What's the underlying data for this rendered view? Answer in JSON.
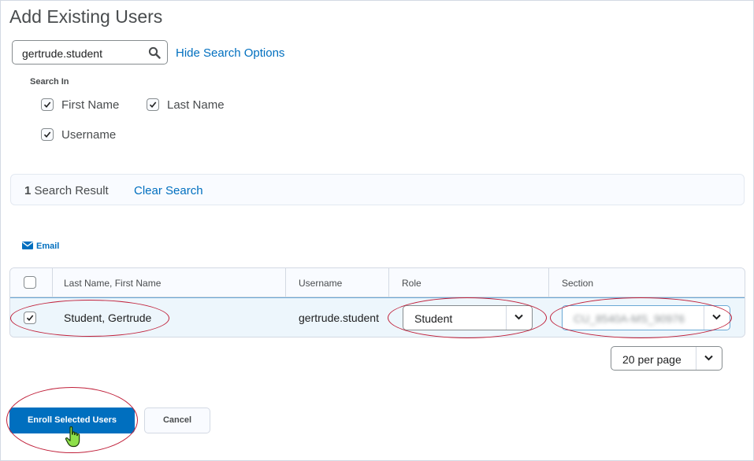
{
  "page": {
    "title": "Add Existing Users"
  },
  "search": {
    "value": "gertrude.student",
    "hide_options_link": "Hide Search Options",
    "search_in_label": "Search In",
    "options": [
      {
        "label": "First Name",
        "checked": true
      },
      {
        "label": "Last Name",
        "checked": true
      },
      {
        "label": "Username",
        "checked": true
      }
    ]
  },
  "results": {
    "count": "1",
    "label": "Search Result",
    "clear_link": "Clear Search"
  },
  "actions": {
    "email_label": "Email"
  },
  "table": {
    "headers": [
      "Last Name, First Name",
      "Username",
      "Role",
      "Section"
    ],
    "rows": [
      {
        "name": "Student, Gertrude",
        "username": "gertrude.student",
        "role": "Student",
        "section": "CU_8540A-MS_90976",
        "selected": true
      }
    ]
  },
  "pagination": {
    "per_page": "20 per page"
  },
  "buttons": {
    "enroll": "Enroll Selected Users",
    "cancel": "Cancel"
  },
  "colors": {
    "accent": "#006fbf",
    "annotation": "#c0203a",
    "selected_row": "#edf6fc"
  },
  "icons": [
    "search-icon",
    "envelope-icon",
    "checkmark-icon",
    "chevron-down-icon",
    "hand-pointer-icon"
  ]
}
